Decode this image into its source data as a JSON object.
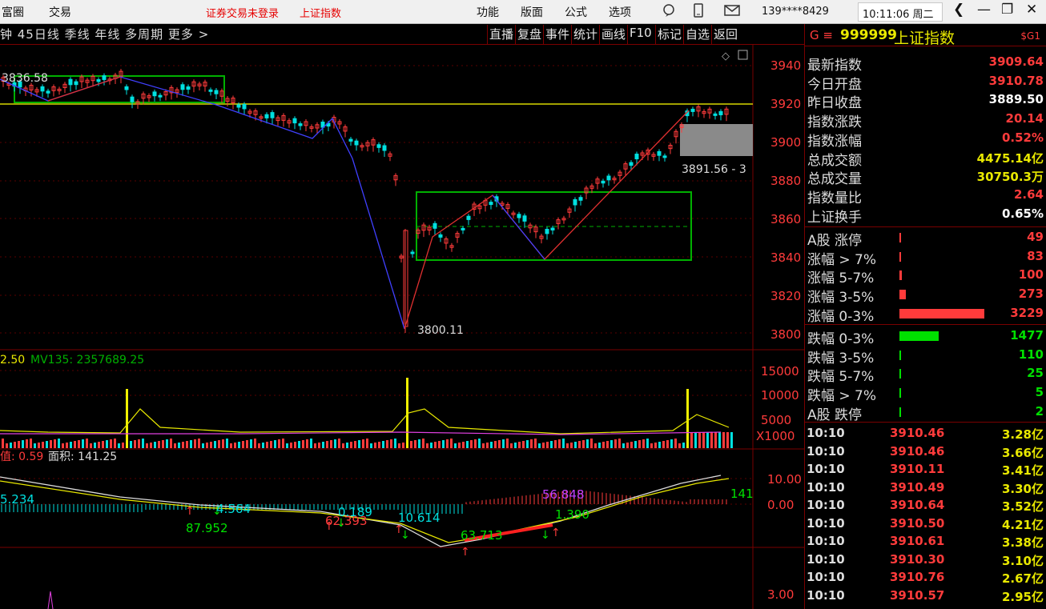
{
  "menu": {
    "app": "富圈",
    "trade": "交易",
    "notice": "证券交易未登录",
    "index_name": "上证指数",
    "items": [
      "功能",
      "版面",
      "公式",
      "选项"
    ],
    "phone": "139****8429",
    "time": "10:11:06 周二"
  },
  "toolbar": {
    "left": "钟 45日线 季线 年线 多周期 更多 >",
    "buttons": [
      "直播",
      "复盘",
      "事件",
      "统计",
      "画线",
      "F10",
      "标记",
      "自选",
      "返回"
    ]
  },
  "price_axis": [
    "3940",
    "3920",
    "3900",
    "3880",
    "3860",
    "3840",
    "3820",
    "3800"
  ],
  "vol_axis": [
    "15000",
    "10000",
    "5000",
    "X1000"
  ],
  "ind_axis": [
    "10.00",
    "0.00",
    "3.00"
  ],
  "annotations": {
    "high": "3836.58",
    "low": "3800.11",
    "gap": "3891.56 - 3",
    "vol_label": "2.50",
    "mv135": "MV135: 2357689.25",
    "ind_label": "值: 0.59",
    "area": "面积: 141.25",
    "ind_vals": [
      "5.234",
      "87.952",
      "4.564",
      "0.189",
      "62.393",
      "10.614",
      "63.713",
      "56.848",
      "1.390",
      "141"
    ]
  },
  "quote": {
    "code": "999999",
    "name": "上证指数",
    "badge": "$G1",
    "rows": [
      {
        "label": "最新指数",
        "value": "3909.64",
        "color": "#ff3b3b"
      },
      {
        "label": "今日开盘",
        "value": "3910.78",
        "color": "#ff3b3b"
      },
      {
        "label": "昨日收盘",
        "value": "3889.50",
        "color": "#ffffff"
      },
      {
        "label": "指数涨跌",
        "value": "20.14",
        "color": "#ff3b3b"
      },
      {
        "label": "指数涨幅",
        "value": "0.52%",
        "color": "#ff3b3b"
      },
      {
        "label": "总成交额",
        "value": "4475.14亿",
        "color": "#e8e800"
      },
      {
        "label": "总成交量",
        "value": "30750.3万",
        "color": "#e8e800"
      },
      {
        "label": "指数量比",
        "value": "2.64",
        "color": "#ff3b3b"
      },
      {
        "label": "上证换手",
        "value": "0.65%",
        "color": "#ffffff"
      }
    ]
  },
  "breadth": [
    {
      "label": "A股 涨停",
      "value": "49",
      "color": "#ff3b3b",
      "frac": 0.003
    },
    {
      "label": "涨幅 > 7%",
      "value": "83",
      "color": "#ff3b3b",
      "frac": 0.02
    },
    {
      "label": "涨幅 5-7%",
      "value": "100",
      "color": "#ff3b3b",
      "frac": 0.025
    },
    {
      "label": "涨幅 3-5%",
      "value": "273",
      "color": "#ff3b3b",
      "frac": 0.08
    },
    {
      "label": "涨幅 0-3%",
      "value": "3229",
      "color": "#ff3b3b",
      "frac": 1
    },
    {
      "label": "跌幅 0-3%",
      "value": "1477",
      "color": "#00e000",
      "frac": 0.46
    },
    {
      "label": "跌幅 3-5%",
      "value": "110",
      "color": "#00e000",
      "frac": 0.02
    },
    {
      "label": "跌幅 5-7%",
      "value": "25",
      "color": "#00e000",
      "frac": 0.003
    },
    {
      "label": "跌幅 > 7%",
      "value": "5",
      "color": "#00e000",
      "frac": 0.003
    },
    {
      "label": "A股 跌停",
      "value": "2",
      "color": "#00e000",
      "frac": 0.003
    }
  ],
  "ticks": [
    {
      "t": "10:10",
      "p": "3910.46",
      "v": "3.28亿"
    },
    {
      "t": "10:10",
      "p": "3910.46",
      "v": "3.66亿"
    },
    {
      "t": "10:10",
      "p": "3910.11",
      "v": "3.41亿"
    },
    {
      "t": "10:10",
      "p": "3910.49",
      "v": "3.30亿"
    },
    {
      "t": "10:10",
      "p": "3910.64",
      "v": "3.52亿"
    },
    {
      "t": "10:10",
      "p": "3910.50",
      "v": "4.21亿"
    },
    {
      "t": "10:10",
      "p": "3910.61",
      "v": "3.38亿"
    },
    {
      "t": "10:10",
      "p": "3910.30",
      "v": "3.10亿"
    },
    {
      "t": "10:10",
      "p": "3910.76",
      "v": "2.67亿"
    },
    {
      "t": "10:10",
      "p": "3910.57",
      "v": "2.95亿"
    }
  ]
}
